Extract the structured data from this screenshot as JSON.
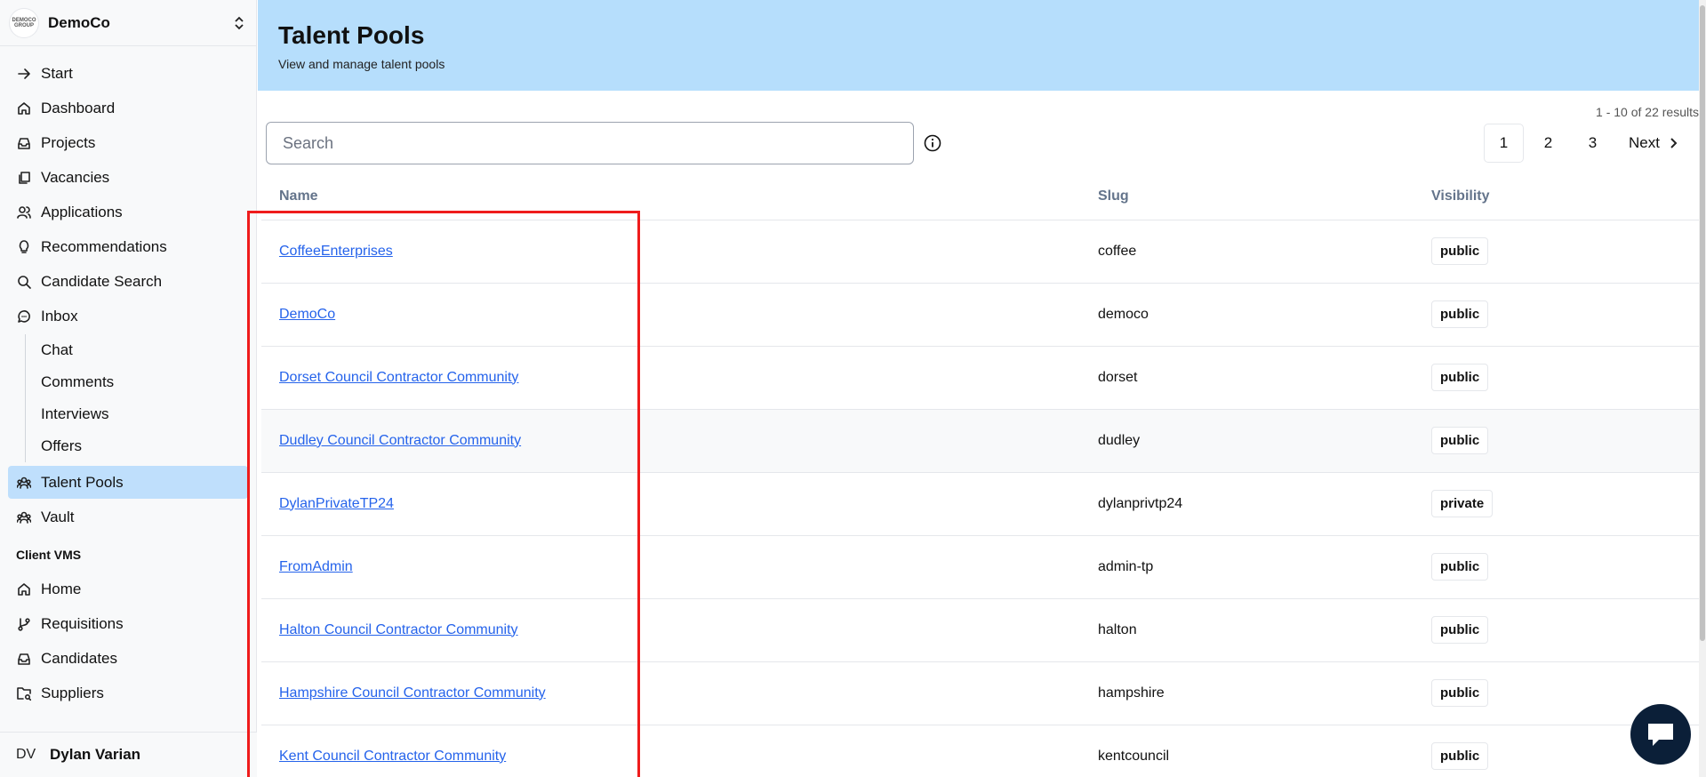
{
  "org": {
    "name": "DemoCo",
    "logo_text": "DEMOCO GROUP"
  },
  "nav": {
    "items": [
      {
        "label": "Start",
        "icon": "arrow-right-icon"
      },
      {
        "label": "Dashboard",
        "icon": "home-icon"
      },
      {
        "label": "Projects",
        "icon": "inbox-stack-icon"
      },
      {
        "label": "Vacancies",
        "icon": "copy-icon"
      },
      {
        "label": "Applications",
        "icon": "users-icon"
      },
      {
        "label": "Recommendations",
        "icon": "lightbulb-icon"
      },
      {
        "label": "Candidate Search",
        "icon": "search-icon"
      },
      {
        "label": "Inbox",
        "icon": "message-circle-icon"
      }
    ],
    "inbox_sub": [
      "Chat",
      "Comments",
      "Interviews",
      "Offers"
    ],
    "after": [
      {
        "label": "Talent Pools",
        "icon": "group-icon",
        "active": true
      },
      {
        "label": "Vault",
        "icon": "group-icon"
      }
    ],
    "section_label": "Client VMS",
    "vms": [
      {
        "label": "Home",
        "icon": "home-icon"
      },
      {
        "label": "Requisitions",
        "icon": "git-branch-icon"
      },
      {
        "label": "Candidates",
        "icon": "inbox-stack-icon"
      },
      {
        "label": "Suppliers",
        "icon": "folder-search-icon"
      }
    ]
  },
  "user": {
    "initials": "DV",
    "name": "Dylan Varian"
  },
  "header": {
    "title": "Talent Pools",
    "subtitle": "View and manage talent pools"
  },
  "results": "1 - 10 of 22 results",
  "search": {
    "placeholder": "Search"
  },
  "pager": {
    "pages": [
      "1",
      "2",
      "3"
    ],
    "current": "1",
    "next": "Next"
  },
  "table": {
    "columns": [
      "Name",
      "Slug",
      "Visibility"
    ],
    "rows": [
      {
        "name": "CoffeeEnterprises",
        "slug": "coffee",
        "visibility": "public"
      },
      {
        "name": "DemoCo",
        "slug": "democo",
        "visibility": "public"
      },
      {
        "name": "Dorset Council Contractor Community",
        "slug": "dorset",
        "visibility": "public"
      },
      {
        "name": "Dudley Council Contractor Community",
        "slug": "dudley",
        "visibility": "public"
      },
      {
        "name": "DylanPrivateTP24",
        "slug": "dylanprivtp24",
        "visibility": "private"
      },
      {
        "name": "FromAdmin",
        "slug": "admin-tp",
        "visibility": "public"
      },
      {
        "name": "Halton Council Contractor Community",
        "slug": "halton",
        "visibility": "public"
      },
      {
        "name": "Hampshire Council Contractor Community",
        "slug": "hampshire",
        "visibility": "public"
      },
      {
        "name": "Kent Council Contractor Community",
        "slug": "kentcouncil",
        "visibility": "public"
      }
    ]
  },
  "colors": {
    "header_bg": "#b6defc",
    "active_nav": "#bfdffc",
    "link": "#2563eb",
    "highlight": "#ef1c1c"
  }
}
